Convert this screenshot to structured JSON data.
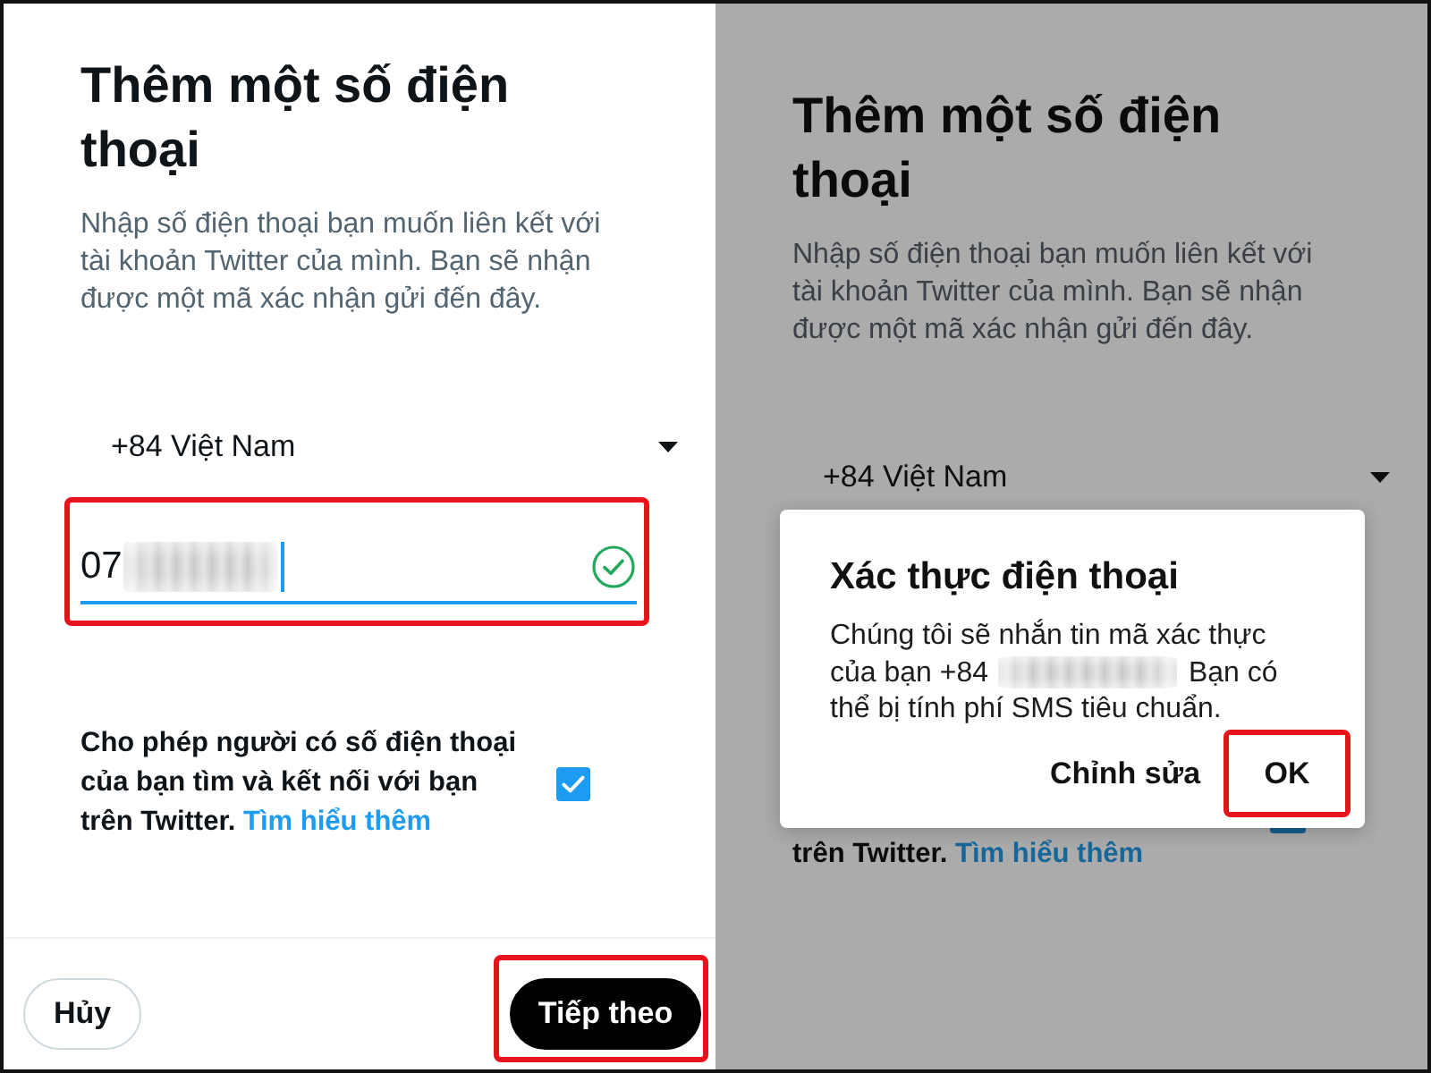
{
  "left_screen": {
    "dimmed": false,
    "title": "Thêm một số điện thoại",
    "description": "Nhập số điện thoại bạn muốn liên kết với tài khoản Twitter của mình. Bạn sẽ nhận được một mã xác nhận gửi đến đây.",
    "country_select": {
      "value": "+84 Việt Nam"
    },
    "phone_field": {
      "value": "07",
      "focused": true,
      "valid": true,
      "highlighted": true
    },
    "contacts_option": {
      "text": "Cho phép người có số điện thoại của bạn tìm và kết nối với bạn trên Twitter.",
      "link": "Tìm hiểu thêm",
      "checked": true
    },
    "buttons": [
      {
        "label": "Hủy",
        "kind": "outline",
        "highlighted": false
      },
      {
        "label": "Tiếp theo",
        "kind": "primary",
        "highlighted": true
      }
    ]
  },
  "right_screen": {
    "dimmed": true,
    "title": "Thêm một số điện thoại",
    "description": "Nhập số điện thoại bạn muốn liên kết với tài khoản Twitter của mình. Bạn sẽ nhận được một mã xác nhận gửi đến đây.",
    "country_select": {
      "value": "+84 Việt Nam"
    },
    "contacts_option": {
      "text": "trên Twitter.",
      "link": "Tìm hiểu thêm",
      "checked": true
    },
    "dialog": {
      "title": "Xác thực điện thoại",
      "message_before": "Chúng tôi sẽ nhắn tin mã xác thực của bạn +84",
      "message_after": "Bạn có thể bị tính phí SMS tiêu chuẩn.",
      "buttons": [
        {
          "label": "Chỉnh sửa",
          "highlighted": false
        },
        {
          "label": "OK",
          "highlighted": true
        }
      ]
    }
  }
}
